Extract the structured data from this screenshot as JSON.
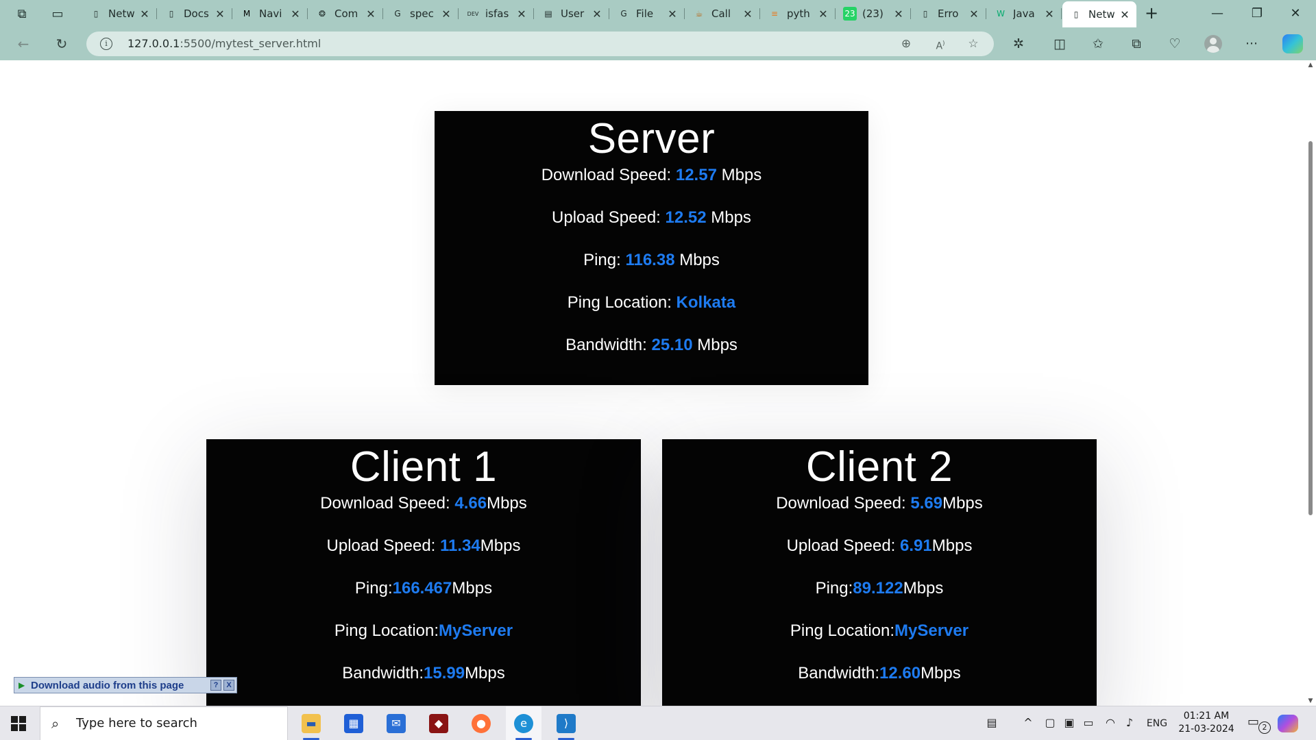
{
  "browser": {
    "tabs": [
      {
        "title": "Netw",
        "icon": "page-icon",
        "bg": "transparent",
        "fg": "#1f2a28",
        "glyph": "▯"
      },
      {
        "title": "Docs",
        "icon": "page-icon",
        "bg": "transparent",
        "fg": "#1f2a28",
        "glyph": "▯"
      },
      {
        "title": "Navi",
        "icon": "medium-icon",
        "bg": "transparent",
        "fg": "#000000",
        "glyph": "M"
      },
      {
        "title": "Com",
        "icon": "chatgpt-icon",
        "bg": "transparent",
        "fg": "#1f2a28",
        "glyph": "❂"
      },
      {
        "title": "spec",
        "icon": "google-icon",
        "bg": "transparent",
        "fg": "#1f2a28",
        "glyph": "G"
      },
      {
        "title": "isfas",
        "icon": "dev-icon",
        "bg": "transparent",
        "fg": "#1f2a28",
        "glyph": "DEV"
      },
      {
        "title": "User",
        "icon": "doc-icon",
        "bg": "transparent",
        "fg": "#1f2a28",
        "glyph": "▤"
      },
      {
        "title": "File",
        "icon": "google-icon",
        "bg": "transparent",
        "fg": "#1f2a28",
        "glyph": "G"
      },
      {
        "title": "Call",
        "icon": "java-icon",
        "bg": "transparent",
        "fg": "#b86a1e",
        "glyph": "☕"
      },
      {
        "title": "pyth",
        "icon": "stackoverflow-icon",
        "bg": "transparent",
        "fg": "#e87c23",
        "glyph": "≡"
      },
      {
        "title": "(23)",
        "icon": "whatsapp-icon",
        "bg": "#25d366",
        "fg": "#ffffff",
        "glyph": "23"
      },
      {
        "title": "Erro",
        "icon": "page-icon",
        "bg": "transparent",
        "fg": "#1f2a28",
        "glyph": "▯"
      },
      {
        "title": "Java",
        "icon": "w3schools-icon",
        "bg": "transparent",
        "fg": "#04aa6d",
        "glyph": "W"
      },
      {
        "title": "Netw",
        "icon": "page-icon",
        "bg": "transparent",
        "fg": "#1f2a28",
        "glyph": "▯",
        "active": true
      }
    ],
    "url_host": "127.0.0.1",
    "url_rest": ":5500/mytest_server.html"
  },
  "server": {
    "title": "Server",
    "download_label": "Download Speed: ",
    "download_value": "12.57",
    "download_unit": " Mbps",
    "upload_label": "Upload Speed: ",
    "upload_value": "12.52",
    "upload_unit": " Mbps",
    "ping_label": "Ping: ",
    "ping_value": "116.38",
    "ping_unit": " Mbps",
    "location_label": "Ping Location: ",
    "location_value": "Kolkata",
    "bandwidth_label": "Bandwidth: ",
    "bandwidth_value": "25.10",
    "bandwidth_unit": " Mbps"
  },
  "client1": {
    "title": "Client 1",
    "download_label": "Download Speed: ",
    "download_value": "4.66",
    "download_unit": "Mbps",
    "upload_label": "Upload Speed: ",
    "upload_value": "11.34",
    "upload_unit": "Mbps",
    "ping_label": "Ping:",
    "ping_value": "166.467",
    "ping_unit": "Mbps",
    "location_label": "Ping Location:",
    "location_value": "MyServer",
    "bandwidth_label": "Bandwidth:",
    "bandwidth_value": "15.99",
    "bandwidth_unit": "Mbps"
  },
  "client2": {
    "title": "Client 2",
    "download_label": "Download Speed: ",
    "download_value": "5.69",
    "download_unit": "Mbps",
    "upload_label": "Upload Speed: ",
    "upload_value": "6.91",
    "upload_unit": "Mbps",
    "ping_label": "Ping:",
    "ping_value": "89.122",
    "ping_unit": "Mbps",
    "location_label": "Ping Location:",
    "location_value": "MyServer",
    "bandwidth_label": "Bandwidth:",
    "bandwidth_value": "12.60",
    "bandwidth_unit": "Mbps"
  },
  "download_bar": {
    "label": "Download audio from this page",
    "help": "?",
    "close": "X"
  },
  "taskbar": {
    "search_placeholder": "Type here to search",
    "language": "ENG",
    "time": "01:21 AM",
    "date": "21-03-2024",
    "notification_count": "2"
  },
  "colors": {
    "accent_value": "#1e7bf0",
    "card_bg": "#040404",
    "chrome": "#a9cbc3"
  }
}
